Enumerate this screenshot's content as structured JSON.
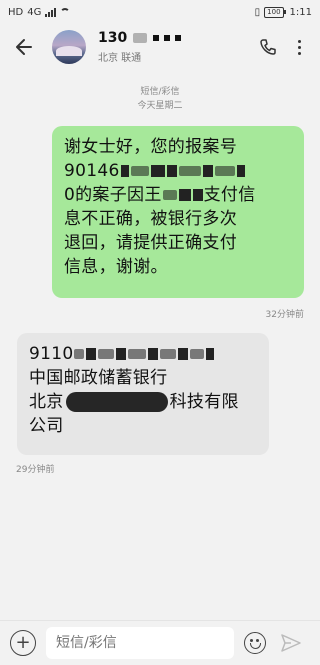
{
  "status_bar": {
    "left_label": "HD",
    "network": "4G",
    "battery_percent": "100",
    "time": "1:11"
  },
  "header": {
    "contact_number": "130",
    "contact_sub": "北京 联通",
    "icons": {
      "back": "back-arrow-icon",
      "call": "phone-icon",
      "more": "more-vertical-icon"
    }
  },
  "meta": {
    "channel": "短信/彩信",
    "date": "今天星期二"
  },
  "messages": [
    {
      "direction": "outgoing",
      "lines": [
        "谢女士好，您的报案号",
        "90146",
        "0的案子因王",
        "支付信",
        "息不正确，被银行多次",
        "退回，请提供正确支付",
        "信息，谢谢。"
      ],
      "time": "32分钟前"
    },
    {
      "direction": "incoming",
      "lines": [
        "9110",
        "中国邮政储蓄银行",
        "北京",
        "科技有限",
        "公司"
      ],
      "time": "29分钟前"
    }
  ],
  "input_bar": {
    "placeholder": "短信/彩信",
    "icons": {
      "add": "add-circle-icon",
      "emoji": "emoji-icon",
      "send": "send-icon"
    }
  }
}
